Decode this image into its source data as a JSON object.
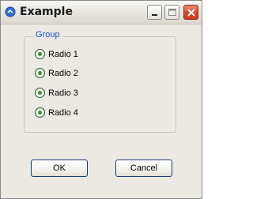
{
  "window": {
    "title": "Example",
    "title_bar_buttons": [
      "minimize",
      "maximize",
      "close"
    ]
  },
  "group": {
    "label": "Group",
    "radios": [
      {
        "label": "Radio 1",
        "checked": true
      },
      {
        "label": "Radio 2",
        "checked": true
      },
      {
        "label": "Radio 3",
        "checked": true
      },
      {
        "label": "Radio 4",
        "checked": true
      }
    ]
  },
  "buttons": {
    "ok_label": "OK",
    "cancel_label": "Cancel"
  },
  "colors": {
    "group_label": "#1f4fd0",
    "radio_dot": "#2c9a33",
    "close_button": "#d8472a"
  }
}
